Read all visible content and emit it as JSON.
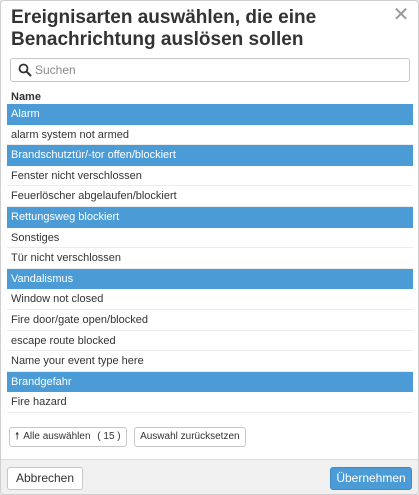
{
  "dialog": {
    "title": "Ereignisarten auswählen, die eine Benachrichtung auslösen sollen",
    "close_icon": "close-icon"
  },
  "search": {
    "placeholder": "Suchen",
    "value": ""
  },
  "list": {
    "column_header": "Name",
    "items": [
      {
        "label": "Alarm",
        "selected": true
      },
      {
        "label": "alarm system not armed",
        "selected": false
      },
      {
        "label": "Brandschutztür/-tor offen/blockiert",
        "selected": true
      },
      {
        "label": "Fenster nicht verschlossen",
        "selected": false
      },
      {
        "label": "Feuerlöscher abgelaufen/blockiert",
        "selected": false
      },
      {
        "label": "Rettungsweg blockiert",
        "selected": true
      },
      {
        "label": "Sonstiges",
        "selected": false
      },
      {
        "label": "Tür nicht verschlossen",
        "selected": false
      },
      {
        "label": "Vandalismus",
        "selected": true
      },
      {
        "label": "Window not closed",
        "selected": false
      },
      {
        "label": "Fire door/gate open/blocked",
        "selected": false
      },
      {
        "label": "escape route blocked",
        "selected": false
      },
      {
        "label": "Name your event type here",
        "selected": false
      },
      {
        "label": "Brandgefahr",
        "selected": true
      },
      {
        "label": "Fire hazard",
        "selected": false
      }
    ]
  },
  "selection_buttons": {
    "select_all_label": "Alle auswählen",
    "select_all_count": "( 15 )",
    "reset_label": "Auswahl zurücksetzen"
  },
  "footer": {
    "cancel_label": "Abbrechen",
    "apply_label": "Übernehmen"
  },
  "colors": {
    "selected_row": "#4b9cd6",
    "primary_button": "#4b9cd6"
  }
}
